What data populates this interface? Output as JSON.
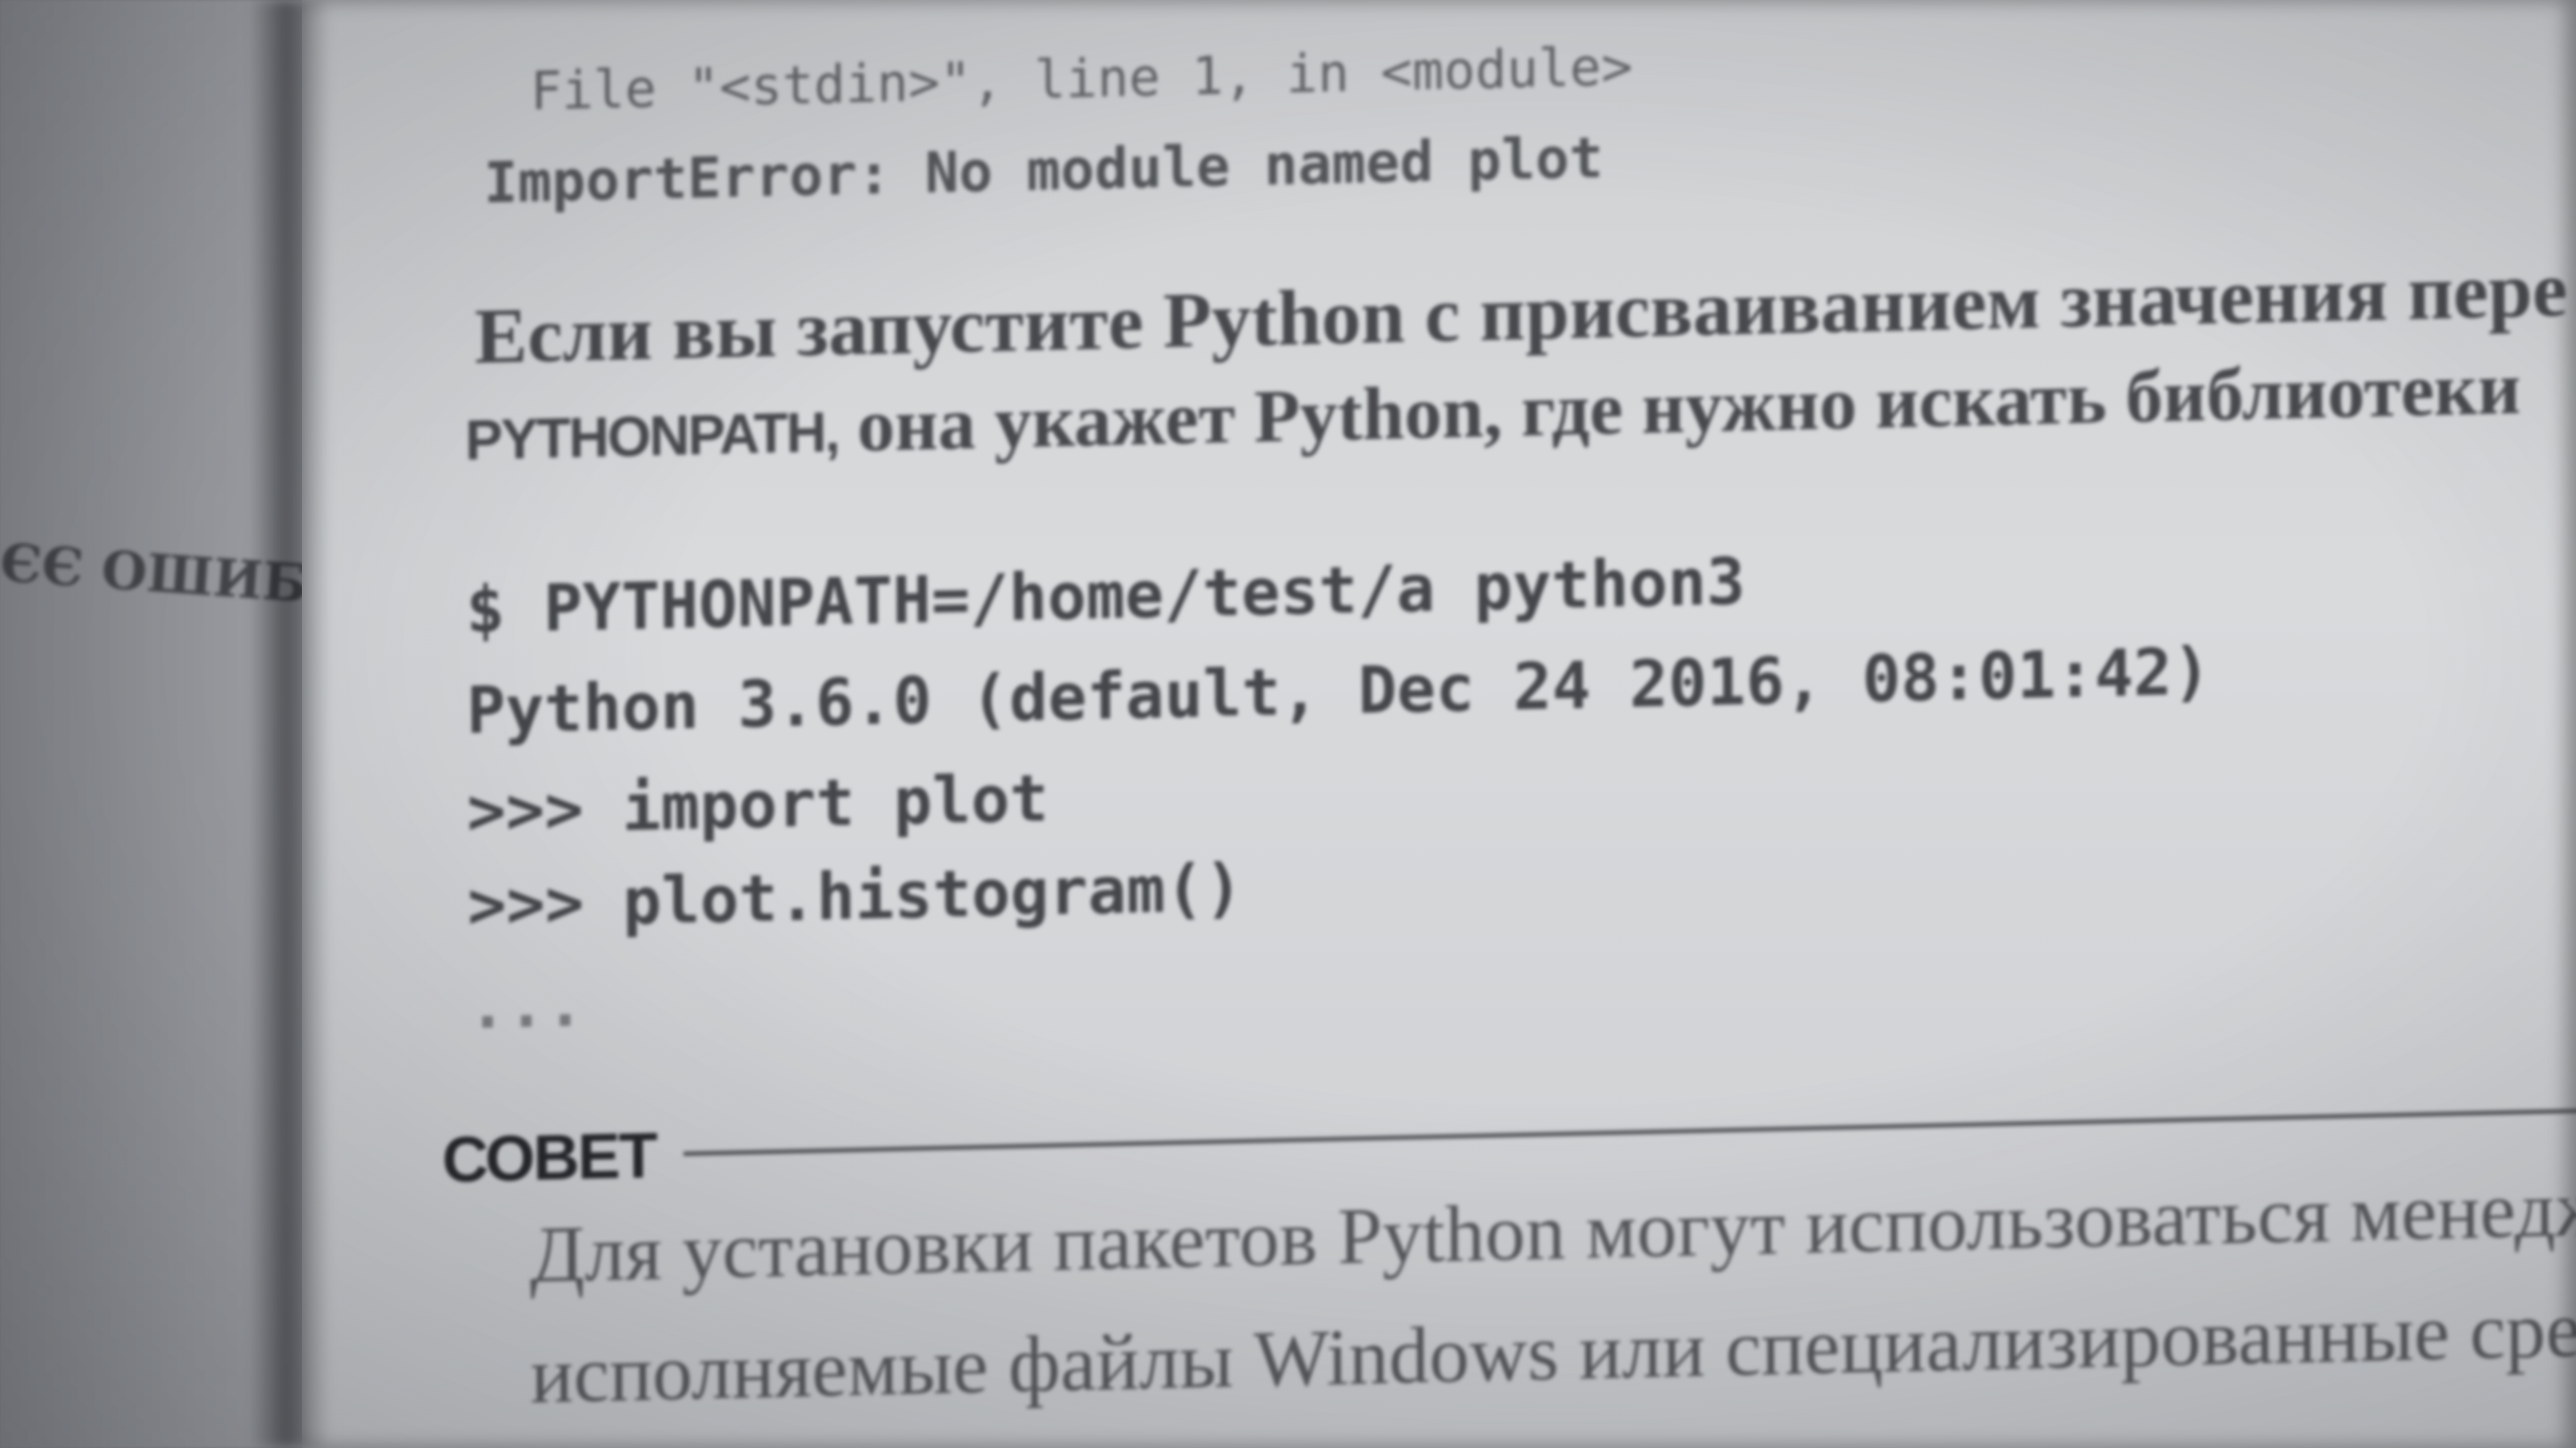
{
  "left_page": {
    "fragment": "ЄЄ ОШИБ"
  },
  "traceback": {
    "line1": "File \"<stdin>\", line 1, in <module>",
    "line2": "ImportError: No module named plot"
  },
  "paragraph1": {
    "line1": "Если вы запустите Python с присваиванием значения пере",
    "line2_var": "PYTHONPATH,",
    "line2_rest": " она укажет Python, где нужно искать библиотеки"
  },
  "code_block": {
    "line1": "$ PYTHONPATH=/home/test/a python3",
    "line2": "Python 3.6.0 (default, Dec 24 2016, 08:01:42)",
    "line3": ">>> import plot",
    "line4": ">>> plot.histogram()",
    "line5": "..."
  },
  "tip": {
    "title": "СОВЕТ",
    "line1": "Для установки пакетов Python могут использоваться менедж",
    "line2": "исполняемые файлы Windows или специализированные сре"
  }
}
